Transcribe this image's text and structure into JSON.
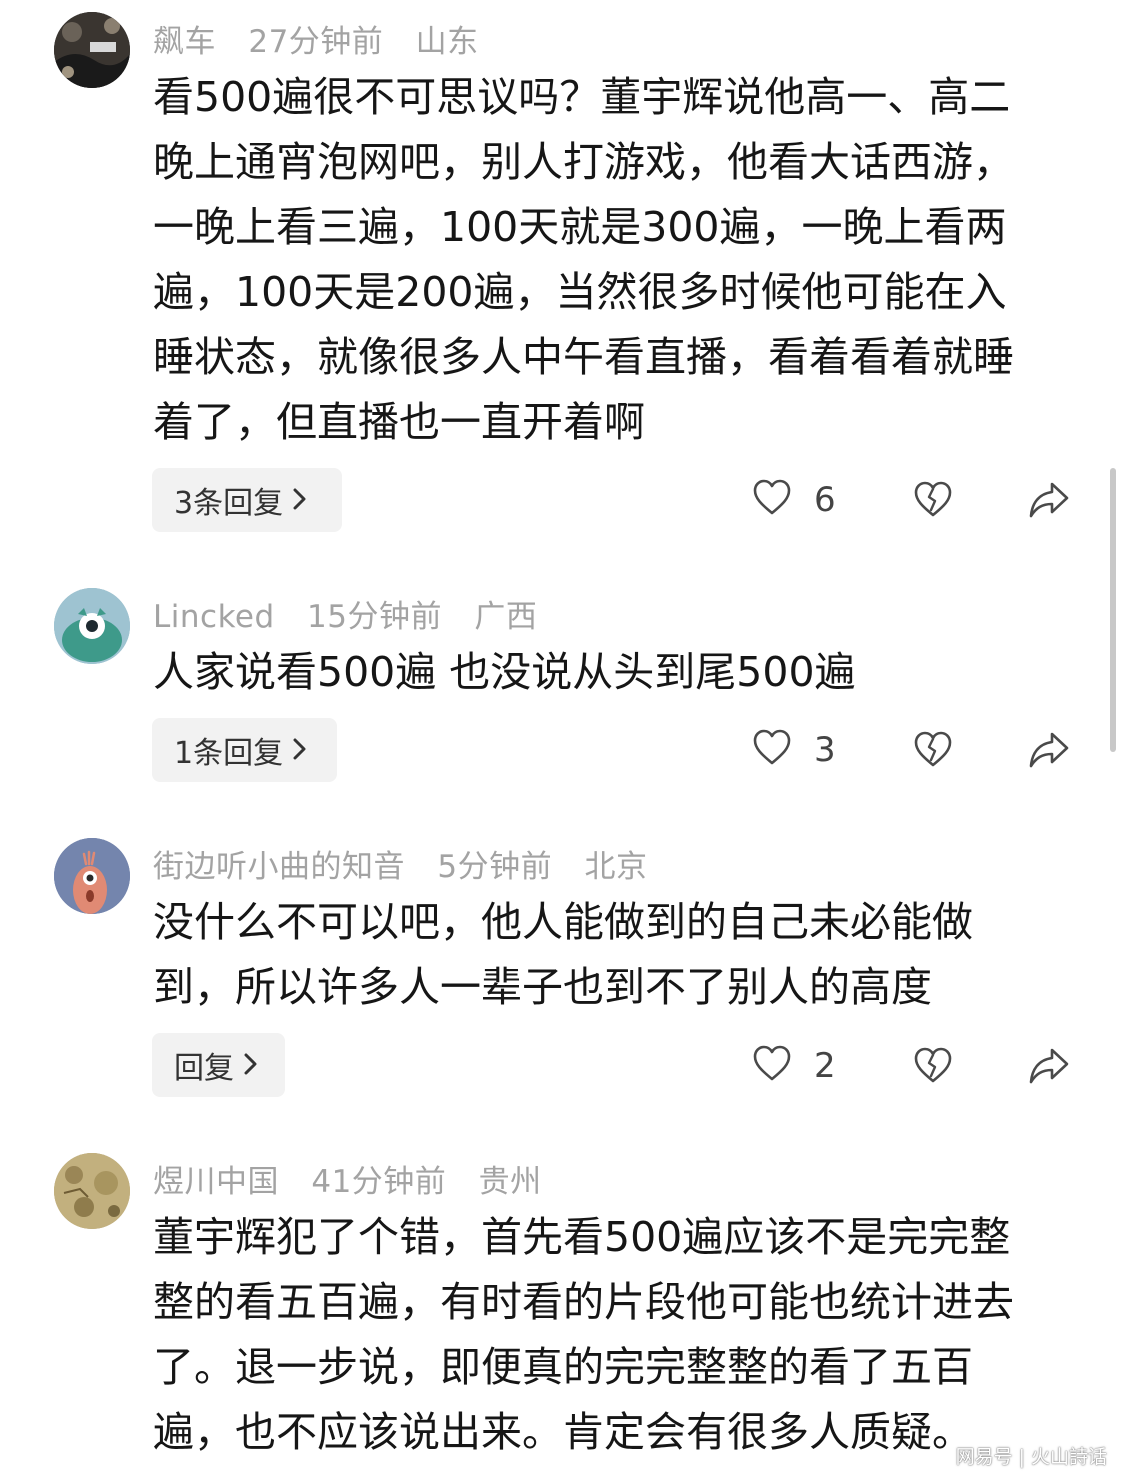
{
  "comments": [
    {
      "username": "飙车",
      "time": "27分钟前",
      "location": "山东",
      "lines": [
        "看500遍很不可思议吗？董宇辉说他高一、高二",
        "晚上通宵泡网吧，别人打游戏，他看大话西游，",
        "一晚上看三遍，100天就是300遍，一晚上看两",
        "遍，100天是200遍，当然很多时候他可能在入",
        "睡状态，就像很多人中午看直播，看着看着就睡",
        "着了，但直播也一直开着啊"
      ],
      "reply_label": "3条回复",
      "likes": "6"
    },
    {
      "username": "Lincked",
      "time": "15分钟前",
      "location": "广西",
      "lines": [
        "人家说看500遍 也没说从头到尾500遍"
      ],
      "reply_label": "1条回复",
      "likes": "3"
    },
    {
      "username": "街边听小曲的知音",
      "time": "5分钟前",
      "location": "北京",
      "lines": [
        "没什么不可以吧，他人能做到的自己未必能做",
        "到，所以许多人一辈子也到不了别人的高度"
      ],
      "reply_label": "回复",
      "likes": "2"
    },
    {
      "username": "煜川中国",
      "time": "41分钟前",
      "location": "贵州",
      "lines": [
        "董宇辉犯了个错，首先看500遍应该不是完完整",
        "整的看五百遍，有时看的片段他可能也统计进去",
        "了。退一步说，即便真的完完整整的看了五百",
        "遍，也不应该说出来。肯定会有很多人质疑。"
      ]
    }
  ],
  "icons": {
    "chevron": "chevron-right-icon",
    "like": "heart-icon",
    "dislike": "broken-heart-icon",
    "share": "share-arrow-icon"
  },
  "watermark": {
    "left": "网易号",
    "separator": "|",
    "right": "火山詩话"
  }
}
